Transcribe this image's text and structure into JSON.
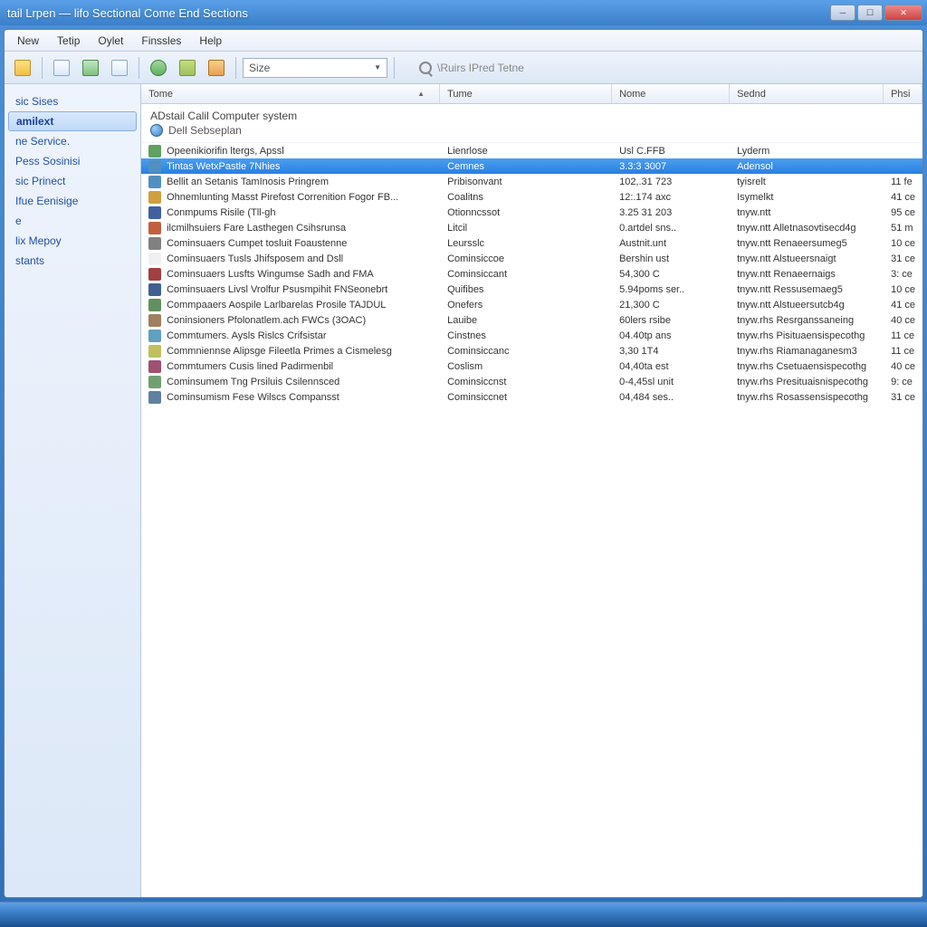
{
  "window": {
    "title": "tail Lrpen  — lifo Sectional Come End Sections"
  },
  "menubar": [
    "New",
    "Tetip",
    "Oylet",
    "Finssles",
    "Help"
  ],
  "toolbar": {
    "select_label": "Size",
    "search_placeholder": "\\Ruirs IPred Tetne"
  },
  "sidebar": {
    "items": [
      {
        "label": "sic Sises",
        "selected": false
      },
      {
        "label": "amilext",
        "selected": true
      },
      {
        "label": "ne Service.",
        "selected": false
      },
      {
        "label": "Pess Sosinisi",
        "selected": false
      },
      {
        "label": "sic Prinect",
        "selected": false
      },
      {
        "label": "Ifue Eenisige",
        "selected": false
      },
      {
        "label": "e",
        "selected": false
      },
      {
        "label": "lix Mepoy",
        "selected": false
      },
      {
        "label": "stants",
        "selected": false
      }
    ]
  },
  "colheaders": {
    "c1": "Tome",
    "c2": "Tume",
    "c3": "Nome",
    "c4": "Sednd",
    "c5": "Phsi"
  },
  "breadcrumb": {
    "line1": "ADstail Calil Computer system",
    "line2": "Dell Sebseplan"
  },
  "rows": [
    {
      "icon": "#60a060",
      "name": "Opeenikiorifin ltergs, Apssl",
      "tume": "Lienrlose",
      "nome": "Usl C.FFB",
      "sednd": "Lyderm",
      "ph": "",
      "selected": false
    },
    {
      "icon": "#5090c0",
      "name": "Tintas   WetxPastle 7Nhies",
      "tume": "Cemnes",
      "nome": "3.3:3 3007",
      "sednd": "Adensol",
      "ph": "",
      "selected": true
    },
    {
      "icon": "#5090c0",
      "name": "Bellit an Setanis TamInosis Pringrem",
      "tume": "Pribisonvant",
      "nome": "102,.31 723",
      "sednd": "tyisrelt",
      "ph": "11 fe",
      "selected": false
    },
    {
      "icon": "#d0a040",
      "name": "Ohnemlunting Masst Pirefost Correnition Fogor FB...",
      "tume": "Coalitns",
      "nome": "12:.174 axc",
      "sednd": "Isymelkt",
      "ph": "41 ce",
      "selected": false
    },
    {
      "icon": "#4060a0",
      "name": "Conmpums Risile (Tll-gh",
      "tume": "Otionncssot",
      "nome": "3.25 31 203",
      "sednd": "tnyw.ntt",
      "ph": "95 ce",
      "selected": false
    },
    {
      "icon": "#c06040",
      "name": "ilcmilhsuiers Fare Lasthegen Csihsrunsa",
      "tume": "Litcil",
      "nome": "0.artdel sns..",
      "sednd": "tnyw.ntt  Alletnasovtisecd4g",
      "ph": "51 m",
      "selected": false
    },
    {
      "icon": "#808080",
      "name": "Cominsuaers Cumpet tosluit Foaustenne",
      "tume": "Leursslc",
      "nome": "Austnit.unt",
      "sednd": "tnyw.ntt  Renaeersumeg5",
      "ph": "10 ce",
      "selected": false
    },
    {
      "icon": "#f0f0f0",
      "name": "Cominsuaers Tusls Jhifsposem and Dsll",
      "tume": "Cominsiccoe",
      "nome": "Bershin ust",
      "sednd": "tnyw.ntt  Alstueersnaigt",
      "ph": "31 ce",
      "selected": false
    },
    {
      "icon": "#a04040",
      "name": "Cominsuaers Lusfts Wingumse Sadh and FMA",
      "tume": "Cominsiccant",
      "nome": "54,300 C",
      "sednd": "tnyw.ntt  Renaeernaigs",
      "ph": "3: ce",
      "selected": false
    },
    {
      "icon": "#406090",
      "name": "Cominsuaers Livsl Vrolfur Psusmpihit FNSeonebrt",
      "tume": "Quifibes",
      "nome": "5.94poms ser..",
      "sednd": "tnyw.ntt  Ressusemaeg5",
      "ph": "10 ce",
      "selected": false
    },
    {
      "icon": "#609060",
      "name": "Commpaaers Aospile Larlbarelas Prosile TAJDUL",
      "tume": "Onefers",
      "nome": "21,300 C",
      "sednd": "tnyw.ntt  Alstueersutcb4g",
      "ph": "41 ce",
      "selected": false
    },
    {
      "icon": "#a08060",
      "name": "Coninsioners Pfolonatlem.ach FWCs (3OAC)",
      "tume": "Lauibe",
      "nome": "60lers rsibe",
      "sednd": "tnyw.rhs  Resrganssaneing",
      "ph": "40 ce",
      "selected": false
    },
    {
      "icon": "#60a0c0",
      "name": "Commtumers. Aysls Rislcs Crifsistar",
      "tume": "Cinstnes",
      "nome": "04.40tp ans",
      "sednd": "tnyw.rhs  Pisituaensispecothg",
      "ph": "11 ce",
      "selected": false
    },
    {
      "icon": "#c0c060",
      "name": "Commniennse Alipsge Fileetla Primes a Cismelesg",
      "tume": "Cominsiccanc",
      "nome": "3,30 1T4",
      "sednd": "tnyw.rhs  Riamanaganesm3",
      "ph": "11 ce",
      "selected": false
    },
    {
      "icon": "#a05070",
      "name": "Commtumers  Cusis lined Padirmenbil",
      "tume": "Coslism",
      "nome": "04,40ta est",
      "sednd": "tnyw.rhs  Csetuaensispecothg",
      "ph": "40 ce",
      "selected": false
    },
    {
      "icon": "#70a070",
      "name": "Cominsumem Tng Prsiluis Csilennsced",
      "tume": "Cominsiccnst",
      "nome": "0-4,45sl unit",
      "sednd": "tnyw.rhs  Presituaisnispecothg",
      "ph": "9: ce",
      "selected": false
    },
    {
      "icon": "#6080a0",
      "name": "Cominsumism Fese Wilscs Compansst",
      "tume": "Cominsiccnet",
      "nome": "04,484 ses..",
      "sednd": "tnyw.rhs  Rosassensispecothg",
      "ph": "31 ce",
      "selected": false
    }
  ]
}
